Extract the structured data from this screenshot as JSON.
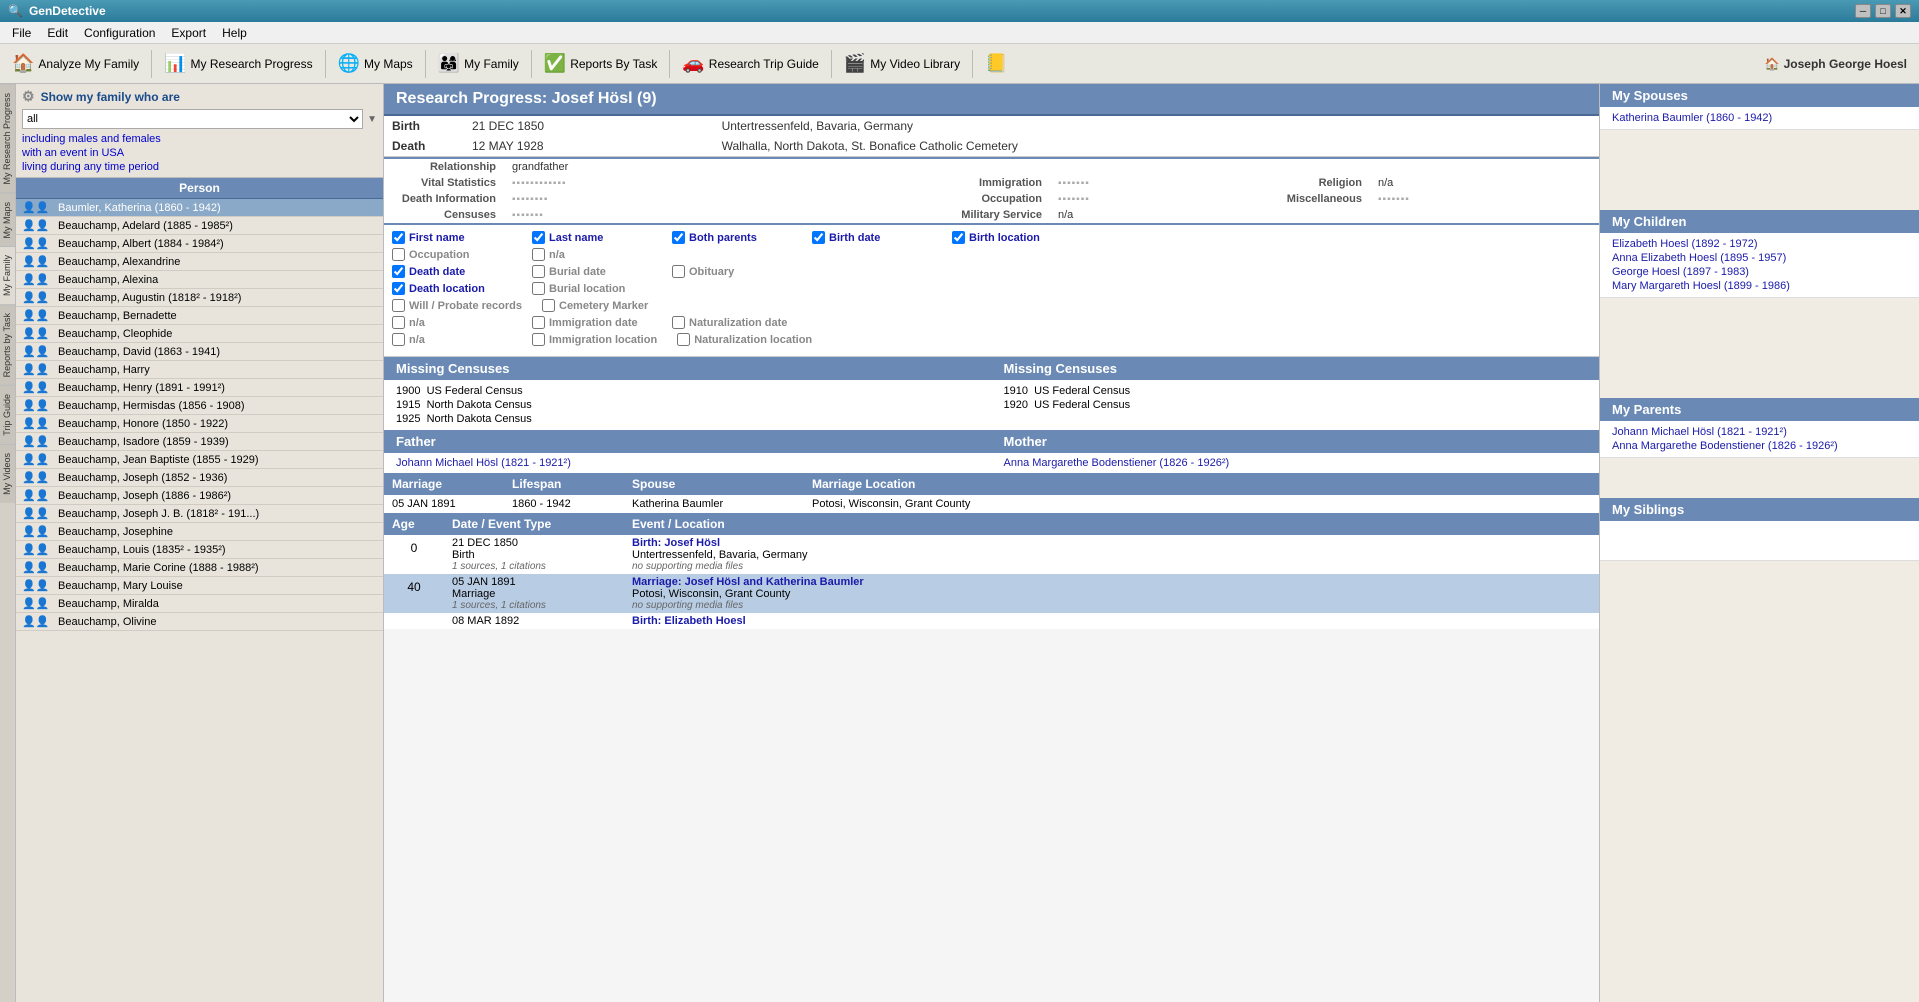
{
  "app": {
    "title": "GenDetective",
    "title_icon": "🔍"
  },
  "titlebar": {
    "title": "GenDetective",
    "minimize": "─",
    "maximize": "□",
    "close": "✕"
  },
  "menubar": {
    "items": [
      "File",
      "Edit",
      "Configuration",
      "Export",
      "Help"
    ]
  },
  "toolbar": {
    "buttons": [
      {
        "id": "analyze",
        "icon": "🏠",
        "label": "Analyze My Family"
      },
      {
        "id": "research",
        "icon": "📊",
        "label": "My Research Progress"
      },
      {
        "id": "maps",
        "icon": "🌐",
        "label": "My Maps"
      },
      {
        "id": "family",
        "icon": "👨‍👩‍👧",
        "label": "My Family"
      },
      {
        "id": "reports",
        "icon": "✅",
        "label": "Reports By Task"
      },
      {
        "id": "trip",
        "icon": "🚗",
        "label": "Research Trip Guide"
      },
      {
        "id": "video",
        "icon": "🎬",
        "label": "My Video Library"
      },
      {
        "id": "bookmark",
        "icon": "📒",
        "label": ""
      }
    ],
    "current_user": "Joseph George Hoesl"
  },
  "sidebar_tabs": [
    "My Research Progress",
    "My Maps",
    "My Family",
    "Reports by Task",
    "Trip Guide",
    "My Videos"
  ],
  "filter": {
    "header": "Show my family who are",
    "select_value": "all",
    "select_options": [
      "all"
    ],
    "line2": "including males and females",
    "line3": "with an event in USA",
    "line4": "living during any time period"
  },
  "person_list": {
    "header": "Person",
    "items": [
      {
        "name": "Baumler, Katherina (1860 - 1942)",
        "selected": true
      },
      {
        "name": "Beauchamp, Adelard (1885 - 1985²)",
        "selected": false
      },
      {
        "name": "Beauchamp, Albert (1884 - 1984²)",
        "selected": false
      },
      {
        "name": "Beauchamp, Alexandrine",
        "selected": false
      },
      {
        "name": "Beauchamp, Alexina",
        "selected": false
      },
      {
        "name": "Beauchamp, Augustin (1818² - 1918²)",
        "selected": false
      },
      {
        "name": "Beauchamp, Bernadette",
        "selected": false
      },
      {
        "name": "Beauchamp, Cleophide",
        "selected": false
      },
      {
        "name": "Beauchamp, David (1863 - 1941)",
        "selected": false
      },
      {
        "name": "Beauchamp, Harry",
        "selected": false
      },
      {
        "name": "Beauchamp, Henry (1891 - 1991²)",
        "selected": false
      },
      {
        "name": "Beauchamp, Hermisdas (1856 - 1908)",
        "selected": false
      },
      {
        "name": "Beauchamp, Honore (1850 - 1922)",
        "selected": false
      },
      {
        "name": "Beauchamp, Isadore (1859 - 1939)",
        "selected": false
      },
      {
        "name": "Beauchamp, Jean Baptiste (1855 - 1929)",
        "selected": false
      },
      {
        "name": "Beauchamp, Joseph (1852 - 1936)",
        "selected": false
      },
      {
        "name": "Beauchamp, Joseph (1886 - 1986²)",
        "selected": false
      },
      {
        "name": "Beauchamp, Joseph J. B. (1818² - 191...)",
        "selected": false
      },
      {
        "name": "Beauchamp, Josephine",
        "selected": false
      },
      {
        "name": "Beauchamp, Louis (1835² - 1935²)",
        "selected": false
      },
      {
        "name": "Beauchamp, Marie Corine (1888 - 1988²)",
        "selected": false
      },
      {
        "name": "Beauchamp, Mary Louise",
        "selected": false
      },
      {
        "name": "Beauchamp, Miralda",
        "selected": false
      },
      {
        "name": "Beauchamp, Olivine",
        "selected": false
      }
    ]
  },
  "research": {
    "title": "Research Progress: Josef Hösl (9)",
    "birth_label": "Birth",
    "birth_date": "21 DEC 1850",
    "birth_place": "Untertressenfeld, Bavaria, Germany",
    "death_label": "Death",
    "death_date": "12 MAY 1928",
    "death_place": "Walhalla, North Dakota, St. Bonafice Catholic Cemetery",
    "relationship_label": "Relationship",
    "relationship_value": "grandfather",
    "vital_stats_label": "Vital Statistics",
    "immigration_label": "Immigration",
    "religion_label": "Religion",
    "religion_value": "n/a",
    "death_info_label": "Death Information",
    "occupation_label": "Occupation",
    "misc_label": "Miscellaneous",
    "censuses_label": "Censuses",
    "military_label": "Military Service",
    "military_value": "n/a"
  },
  "checkboxes": {
    "first_name": {
      "label": "First name",
      "checked": true
    },
    "last_name": {
      "label": "Last name",
      "checked": true
    },
    "both_parents": {
      "label": "Both parents",
      "checked": true
    },
    "birth_date": {
      "label": "Birth date",
      "checked": true
    },
    "birth_location": {
      "label": "Birth location",
      "checked": true
    },
    "occupation": {
      "label": "Occupation",
      "checked": false
    },
    "na1": {
      "label": "n/a",
      "checked": false
    },
    "death_date": {
      "label": "Death date",
      "checked": true
    },
    "burial_date": {
      "label": "Burial date",
      "checked": false
    },
    "obituary": {
      "label": "Obituary",
      "checked": false
    },
    "death_location": {
      "label": "Death location",
      "checked": true
    },
    "burial_location": {
      "label": "Burial location",
      "checked": false
    },
    "will_probate": {
      "label": "Will / Probate records",
      "checked": false
    },
    "cemetery_marker": {
      "label": "Cemetery Marker",
      "checked": false
    },
    "na2": {
      "label": "n/a",
      "checked": false
    },
    "immigration_date": {
      "label": "Immigration date",
      "checked": false
    },
    "naturalization_date": {
      "label": "Naturalization date",
      "checked": false
    },
    "na3": {
      "label": "n/a",
      "checked": false
    },
    "immigration_location": {
      "label": "Immigration location",
      "checked": false
    },
    "naturalization_location": {
      "label": "Naturalization location",
      "checked": false
    }
  },
  "missing_censuses": {
    "left_header": "Missing Censuses",
    "right_header": "Missing Censuses",
    "left_items": [
      "1900  US Federal Census",
      "1915  North Dakota Census",
      "1925  North Dakota Census"
    ],
    "right_items": [
      "1910  US Federal Census",
      "1920  US Federal Census"
    ]
  },
  "parents": {
    "father_header": "Father",
    "mother_header": "Mother",
    "father_name": "Johann Michael Hösl (1821 - 1921²)",
    "mother_name": "Anna Margarethe Bodenstiener (1826 - 1926²)"
  },
  "marriage": {
    "col_date": "Marriage",
    "col_lifespan": "Lifespan",
    "col_spouse": "Spouse",
    "col_location": "Marriage Location",
    "rows": [
      {
        "date": "05 JAN 1891",
        "lifespan": "1860 - 1942",
        "spouse": "Katherina Baumler",
        "location": "Potosi, Wisconsin, Grant County"
      }
    ]
  },
  "events": {
    "col_age": "Age",
    "col_date_type": "Date / Event Type",
    "col_event_location": "Event / Location",
    "rows": [
      {
        "age": "0",
        "highlight": false,
        "date": "21 DEC 1850",
        "type": "Birth",
        "src": "1 sources, 1 citations",
        "event_main": "Birth: Josef Hösl",
        "event_sub": "Untertressenfeld, Bavaria, Germany",
        "event_src": "no supporting media files"
      },
      {
        "age": "40",
        "highlight": true,
        "date": "05 JAN 1891",
        "type": "Marriage",
        "src": "1 sources, 1 citations",
        "event_main": "Marriage: Josef Hösl and Katherina Baumler",
        "event_sub": "Potosi, Wisconsin, Grant County",
        "event_src": "no supporting media files"
      },
      {
        "age": "",
        "highlight": false,
        "date": "08 MAR 1892",
        "type": "",
        "src": "",
        "event_main": "Birth: Elizabeth Hoesl",
        "event_sub": "",
        "event_src": ""
      }
    ]
  },
  "right_panel": {
    "spouses_header": "My Spouses",
    "spouses": [
      "Katherina Baumler (1860 - 1942)"
    ],
    "children_header": "My Children",
    "children": [
      "Elizabeth Hoesl (1892 - 1972)",
      "Anna Elizabeth Hoesl (1895 - 1957)",
      "George Hoesl (1897 - 1983)",
      "Mary Margareth Hoesl (1899 - 1986)"
    ],
    "parents_header": "My Parents",
    "parents": [
      "Johann Michael Hösl (1821 - 1921²)",
      "Anna Margarethe Bodenstiener (1826 - 1926²)"
    ],
    "siblings_header": "My Siblings",
    "siblings": []
  }
}
